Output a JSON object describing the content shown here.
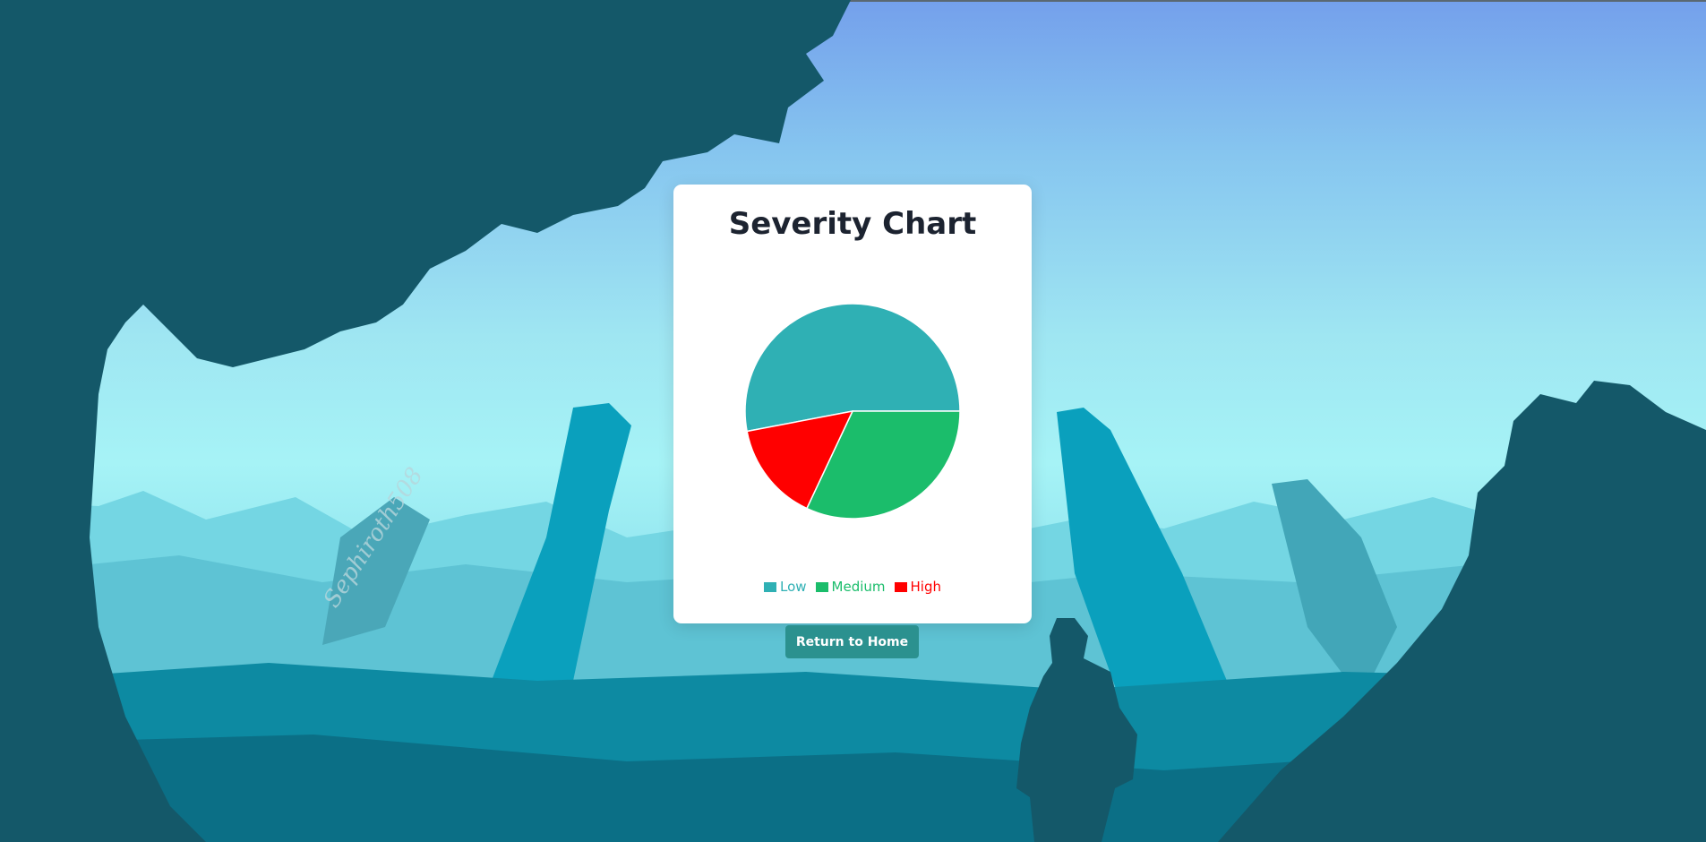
{
  "page": {
    "return_label": "Return to Home",
    "background_signature": "Sephiroth508"
  },
  "colors": {
    "low": "#2fb0b4",
    "medium": "#1bbd6b",
    "high": "#ff0000",
    "button": "#2b918f",
    "title": "#1c2330"
  },
  "chart_data": {
    "type": "pie",
    "title": "Severity Chart",
    "legend_position": "bottom",
    "categories": [
      "Low",
      "Medium",
      "High"
    ],
    "values": [
      53,
      32,
      15
    ],
    "colors": [
      "#2fb0b4",
      "#1bbd6b",
      "#ff0000"
    ]
  }
}
